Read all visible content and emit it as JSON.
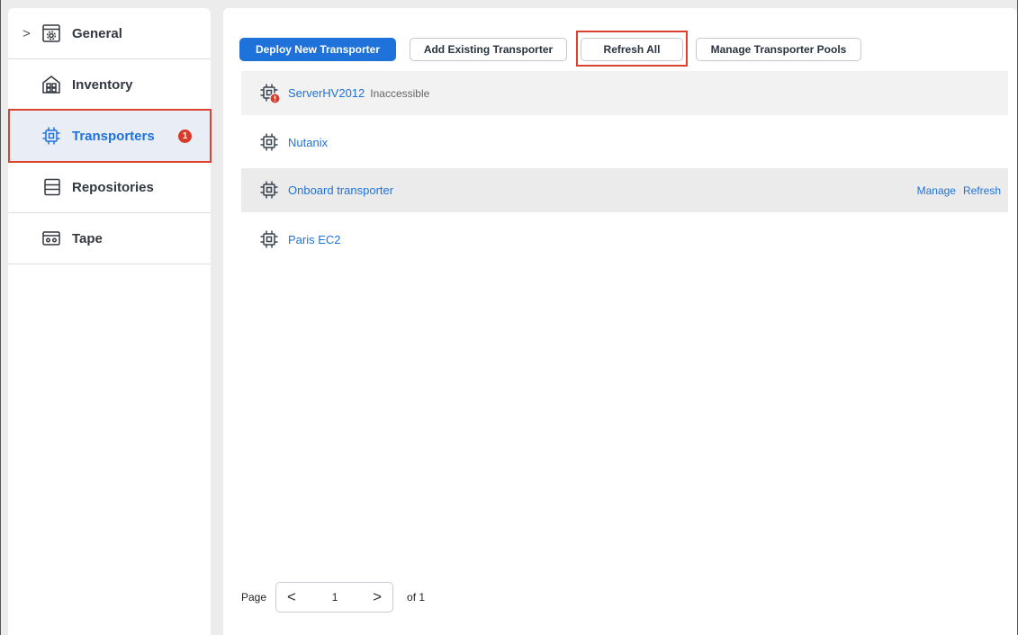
{
  "sidebar": {
    "items": [
      {
        "label": "General",
        "icon": "gear-window-icon",
        "expandable": true
      },
      {
        "label": "Inventory",
        "icon": "inventory-icon"
      },
      {
        "label": "Transporters",
        "icon": "chip-icon",
        "badge": "1",
        "active": true
      },
      {
        "label": "Repositories",
        "icon": "repository-icon"
      },
      {
        "label": "Tape",
        "icon": "tape-icon"
      }
    ],
    "chevron": ">"
  },
  "toolbar": {
    "deploy_label": "Deploy New Transporter",
    "add_label": "Add Existing Transporter",
    "refresh_all_label": "Refresh All",
    "pools_label": "Manage Transporter Pools"
  },
  "transporters": [
    {
      "name": "ServerHV2012",
      "status": "Inaccessible",
      "error": true
    },
    {
      "name": "Nutanix",
      "status": ""
    },
    {
      "name": "Onboard transporter",
      "status": "",
      "actions": [
        "Manage",
        "Refresh"
      ]
    },
    {
      "name": "Paris EC2",
      "status": ""
    }
  ],
  "pager": {
    "page_label": "Page",
    "prev": "<",
    "current": "1",
    "next": ">",
    "of_label": "of 1"
  },
  "colors": {
    "accent": "#1f72d9",
    "highlight": "#d9432f",
    "badge": "#d83a2b"
  }
}
